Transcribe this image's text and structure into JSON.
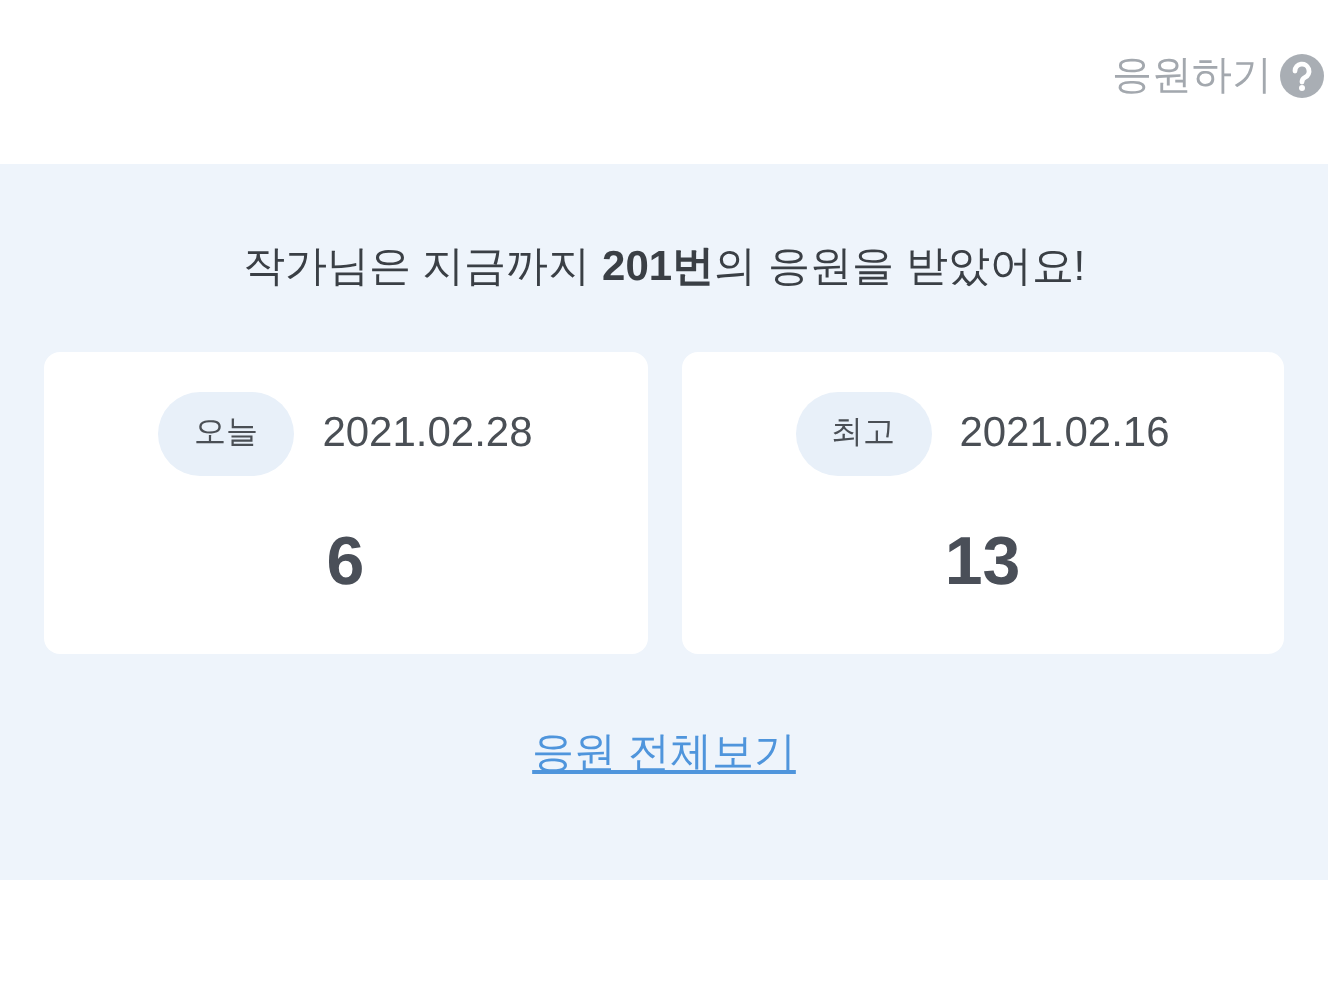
{
  "header": {
    "support_link": "응원하기"
  },
  "summary": "작가님은 지금까지 **201번**의 응원을 받았어요!",
  "cards": [
    {
      "badge": "오늘",
      "date": "2021.02.28",
      "count": "6"
    },
    {
      "badge": "최고",
      "date": "2021.02.16",
      "count": "13"
    }
  ],
  "view_all_link": "응원 전체보기"
}
